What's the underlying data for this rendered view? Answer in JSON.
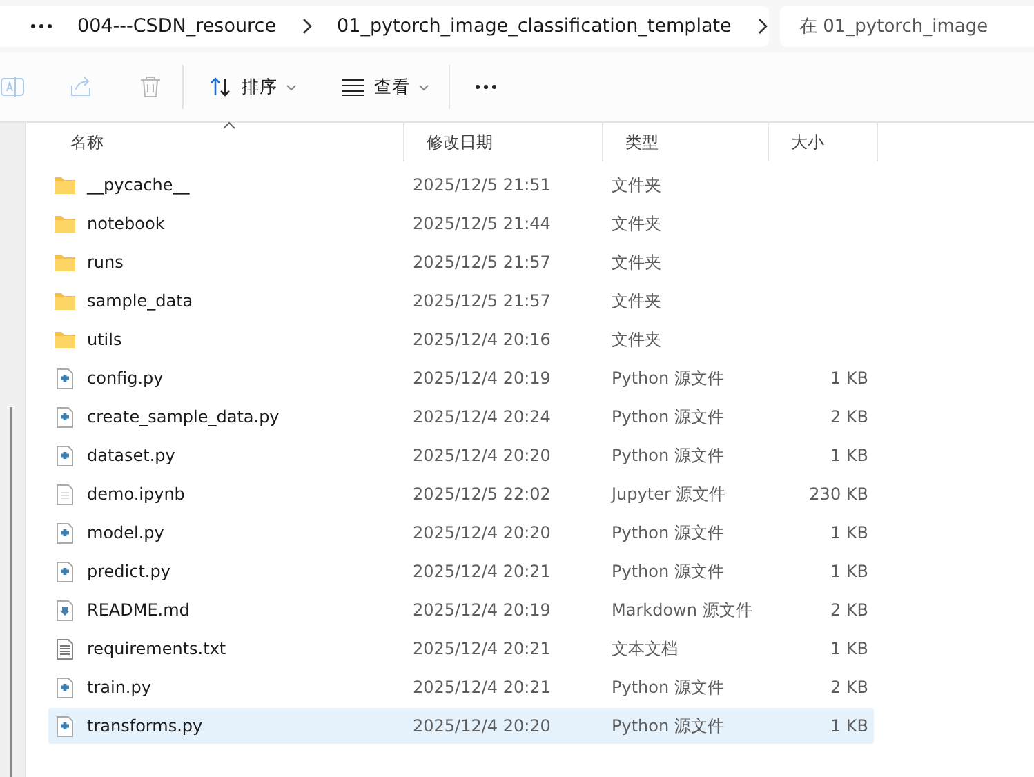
{
  "address_bar": {
    "breadcrumbs": [
      "004---CSDN_resource",
      "01_pytorch_image_classification_template"
    ]
  },
  "search": {
    "placeholder": "在 01_pytorch_image"
  },
  "toolbar": [
    {
      "kind": "rename",
      "disabled": true
    },
    {
      "kind": "share",
      "disabled": true
    },
    {
      "kind": "delete",
      "disabled": true
    },
    {
      "kind": "sort",
      "label": "排序",
      "disabled": false
    },
    {
      "kind": "view",
      "label": "查看",
      "disabled": false
    },
    {
      "kind": "more",
      "disabled": false
    }
  ],
  "table": {
    "columns": [
      {
        "label": "名称",
        "sorted": true
      },
      {
        "label": "修改日期",
        "sorted": false
      },
      {
        "label": "类型",
        "sorted": false
      },
      {
        "label": "大小",
        "sorted": false
      }
    ],
    "rows": [
      {
        "kind": "folder",
        "name": "__pycache__",
        "modified": "2025/12/5 21:51",
        "type": "文件夹",
        "selected": false
      },
      {
        "kind": "folder",
        "name": "notebook",
        "modified": "2025/12/5 21:44",
        "type": "文件夹",
        "selected": false
      },
      {
        "kind": "folder",
        "name": "runs",
        "modified": "2025/12/5 21:57",
        "type": "文件夹",
        "selected": false
      },
      {
        "kind": "folder",
        "name": "sample_data",
        "modified": "2025/12/5 21:57",
        "type": "文件夹",
        "selected": false
      },
      {
        "kind": "folder",
        "name": "utils",
        "modified": "2025/12/4 20:16",
        "type": "文件夹",
        "selected": false
      },
      {
        "kind": "python",
        "name": "config.py",
        "modified": "2025/12/4 20:19",
        "type": "Python 源文件",
        "size": "1 KB",
        "selected": false
      },
      {
        "kind": "python",
        "name": "create_sample_data.py",
        "modified": "2025/12/4 20:24",
        "type": "Python 源文件",
        "size": "2 KB",
        "selected": false
      },
      {
        "kind": "python",
        "name": "dataset.py",
        "modified": "2025/12/4 20:20",
        "type": "Python 源文件",
        "size": "1 KB",
        "selected": false
      },
      {
        "kind": "notebook",
        "name": "demo.ipynb",
        "modified": "2025/12/5 22:02",
        "type": "Jupyter 源文件",
        "size": "230 KB",
        "selected": false
      },
      {
        "kind": "python",
        "name": "model.py",
        "modified": "2025/12/4 20:20",
        "type": "Python 源文件",
        "size": "1 KB",
        "selected": false
      },
      {
        "kind": "python",
        "name": "predict.py",
        "modified": "2025/12/4 20:21",
        "type": "Python 源文件",
        "size": "1 KB",
        "selected": false
      },
      {
        "kind": "markdown",
        "name": "README.md",
        "modified": "2025/12/4 20:19",
        "type": "Markdown 源文件",
        "size": "2 KB",
        "selected": false
      },
      {
        "kind": "text",
        "name": "requirements.txt",
        "modified": "2025/12/4 20:21",
        "type": "文本文档",
        "size": "1 KB",
        "selected": false
      },
      {
        "kind": "python",
        "name": "train.py",
        "modified": "2025/12/4 20:21",
        "type": "Python 源文件",
        "size": "2 KB",
        "selected": false
      },
      {
        "kind": "python",
        "name": "transforms.py",
        "modified": "2025/12/4 20:20",
        "type": "Python 源文件",
        "size": "1 KB",
        "selected": true
      }
    ]
  }
}
